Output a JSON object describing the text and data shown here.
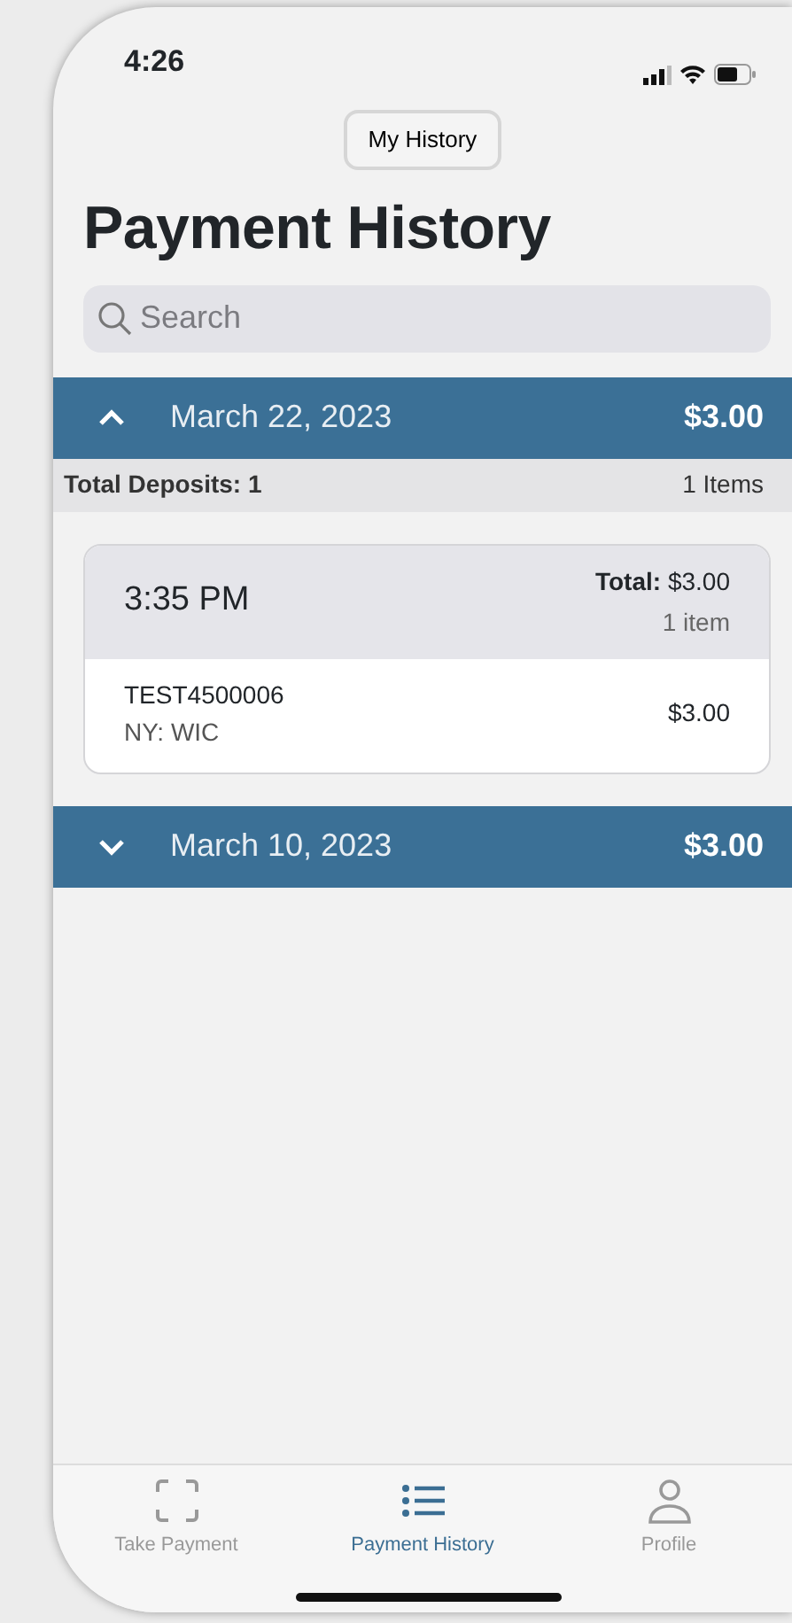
{
  "status_bar": {
    "time": "4:26"
  },
  "header_button": {
    "label": "My History"
  },
  "title": "Payment History",
  "search": {
    "placeholder": "Search"
  },
  "groups": [
    {
      "date": "March 22, 2023",
      "total": "$3.00",
      "expanded": true,
      "summary": {
        "deposits": "Total Deposits: 1",
        "items": "1 Items"
      },
      "transactions": [
        {
          "time": "3:35 PM",
          "total_label": "Total:",
          "total": "$3.00",
          "count": "1 item",
          "lines": [
            {
              "id": "TEST4500006",
              "program": "NY: WIC",
              "amount": "$3.00"
            }
          ]
        }
      ]
    },
    {
      "date": "March 10, 2023",
      "total": "$3.00",
      "expanded": false
    }
  ],
  "tab_bar": [
    {
      "label": "Take Payment",
      "kind": "scan",
      "selected": false
    },
    {
      "label": "Payment History",
      "kind": "list",
      "selected": true
    },
    {
      "label": "Profile",
      "kind": "person",
      "selected": false
    }
  ]
}
